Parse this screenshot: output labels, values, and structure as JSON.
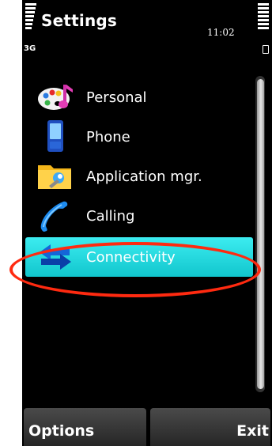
{
  "header": {
    "title": "Settings",
    "clock": "11:02",
    "network": "3G"
  },
  "menu": {
    "items": [
      {
        "label": "Personal",
        "icon": "palette-icon"
      },
      {
        "label": "Phone",
        "icon": "phone-icon"
      },
      {
        "label": "Application mgr.",
        "icon": "folder-wrench-icon"
      },
      {
        "label": "Calling",
        "icon": "handset-icon"
      },
      {
        "label": "Connectivity",
        "icon": "arrows-icon",
        "selected": true
      }
    ]
  },
  "softkeys": {
    "left": "Options",
    "right": "Exit"
  },
  "colors": {
    "highlight": "#2fe0e6",
    "annotation": "#ff2a10",
    "background": "#000000"
  }
}
